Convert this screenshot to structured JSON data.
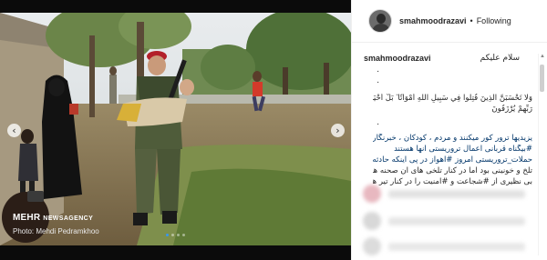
{
  "post": {
    "username": "smahmoodrazavi",
    "separator": "•",
    "follow_status": "Following",
    "greeting": "سلام علیکم",
    "verse_line1": "وَلَا تَحْسَبَنَّ الَّذِينَ قُتِلُوا فِي سَبِيلِ اللَّهِ أَمْوَاتًا ۚ بَلْ أَحْيَاءٌ عِندَ",
    "verse_line2": "رَبِّهِمْ يُرْزَقُونَ",
    "caption_lines": [
      "یزیدیها ترور کور میکنند و مردم ، کودکان ، خبرنگاران",
      "#بیگناه قربانی اعمال تروریستی آنها هستند",
      "حملات_تروریستی امروز #اهواز در پی اینکه حادثه",
      "تلخ و خونینی بود اما در کنار تلخی های آن صحنه های",
      "بی نظیری از #شجاعت و #امنیت را در کنار تیر های"
    ]
  },
  "photo": {
    "watermark_main": "MEHR",
    "watermark_sub": "NEWSAGENCY",
    "credit": "Photo: Mehdi Pedramkhoo",
    "prev_arrow": "‹",
    "next_arrow": "›",
    "carousel_count": 4,
    "carousel_active_index": 0
  },
  "colors": {
    "hashtag": "#003569",
    "active_dot": "#3897f0"
  },
  "icons": {
    "prev": "chevron-left-icon",
    "next": "chevron-right-icon"
  }
}
